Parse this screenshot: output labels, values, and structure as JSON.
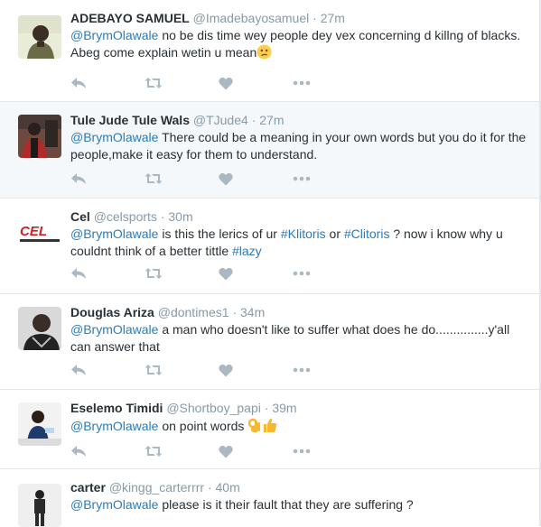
{
  "colors": {
    "link": "#2b7bb9",
    "meta": "#8899a6",
    "action_icon": "#aab8c2",
    "highlight_bg": "#f5f8fa"
  },
  "icons": {
    "reply": "reply-icon",
    "retweet": "retweet-icon",
    "like": "heart-icon",
    "more": "more-dots-icon"
  },
  "tweets": [
    {
      "fullname": "ADEBAYO SAMUEL",
      "handle": "@Imadebayosamuel",
      "separator": "·",
      "time": "27m",
      "mention": "@BrymOlawale",
      "text": " no be dis time wey people dey vex concerning d killng of blacks. Abeg come explain wetin u mean",
      "emoji": "confused-face-emoji"
    },
    {
      "fullname": "Tule Jude Tule Wals",
      "handle": "@TJude4",
      "separator": "·",
      "time": "27m",
      "mention": "@BrymOlawale",
      "text": " There could be a meaning in your own words but you do it for the people,make it easy for them to understand."
    },
    {
      "fullname": "Cel",
      "handle": "@celsports",
      "separator": "·",
      "time": "30m",
      "mention": "@BrymOlawale",
      "text_a": " is this the lerics of ur ",
      "hashtag_1": "#Klitoris",
      "text_b": " or ",
      "hashtag_2": "#Clitoris",
      "text_c": " ? now i know why u couldnt think of a better tittle ",
      "hashtag_3": "#lazy",
      "avatar_text": "CEL"
    },
    {
      "fullname": "Douglas Ariza",
      "handle": "@dontimes1",
      "separator": "·",
      "time": "34m",
      "mention": "@BrymOlawale",
      "text": " a man who doesn't like to suffer what does he do...............y'all can answer that"
    },
    {
      "fullname": "Eselemo Timidi",
      "handle": "@Shortboy_papi",
      "separator": "·",
      "time": "39m",
      "mention": "@BrymOlawale",
      "text": " on point words",
      "emoji": "ok-hand-thumbs-up-emoji"
    },
    {
      "fullname": "carter",
      "handle": "@kingg_carterrrr",
      "separator": "·",
      "time": "40m",
      "mention": "@BrymOlawale",
      "text": " please is it their fault that they are suffering ?"
    }
  ]
}
